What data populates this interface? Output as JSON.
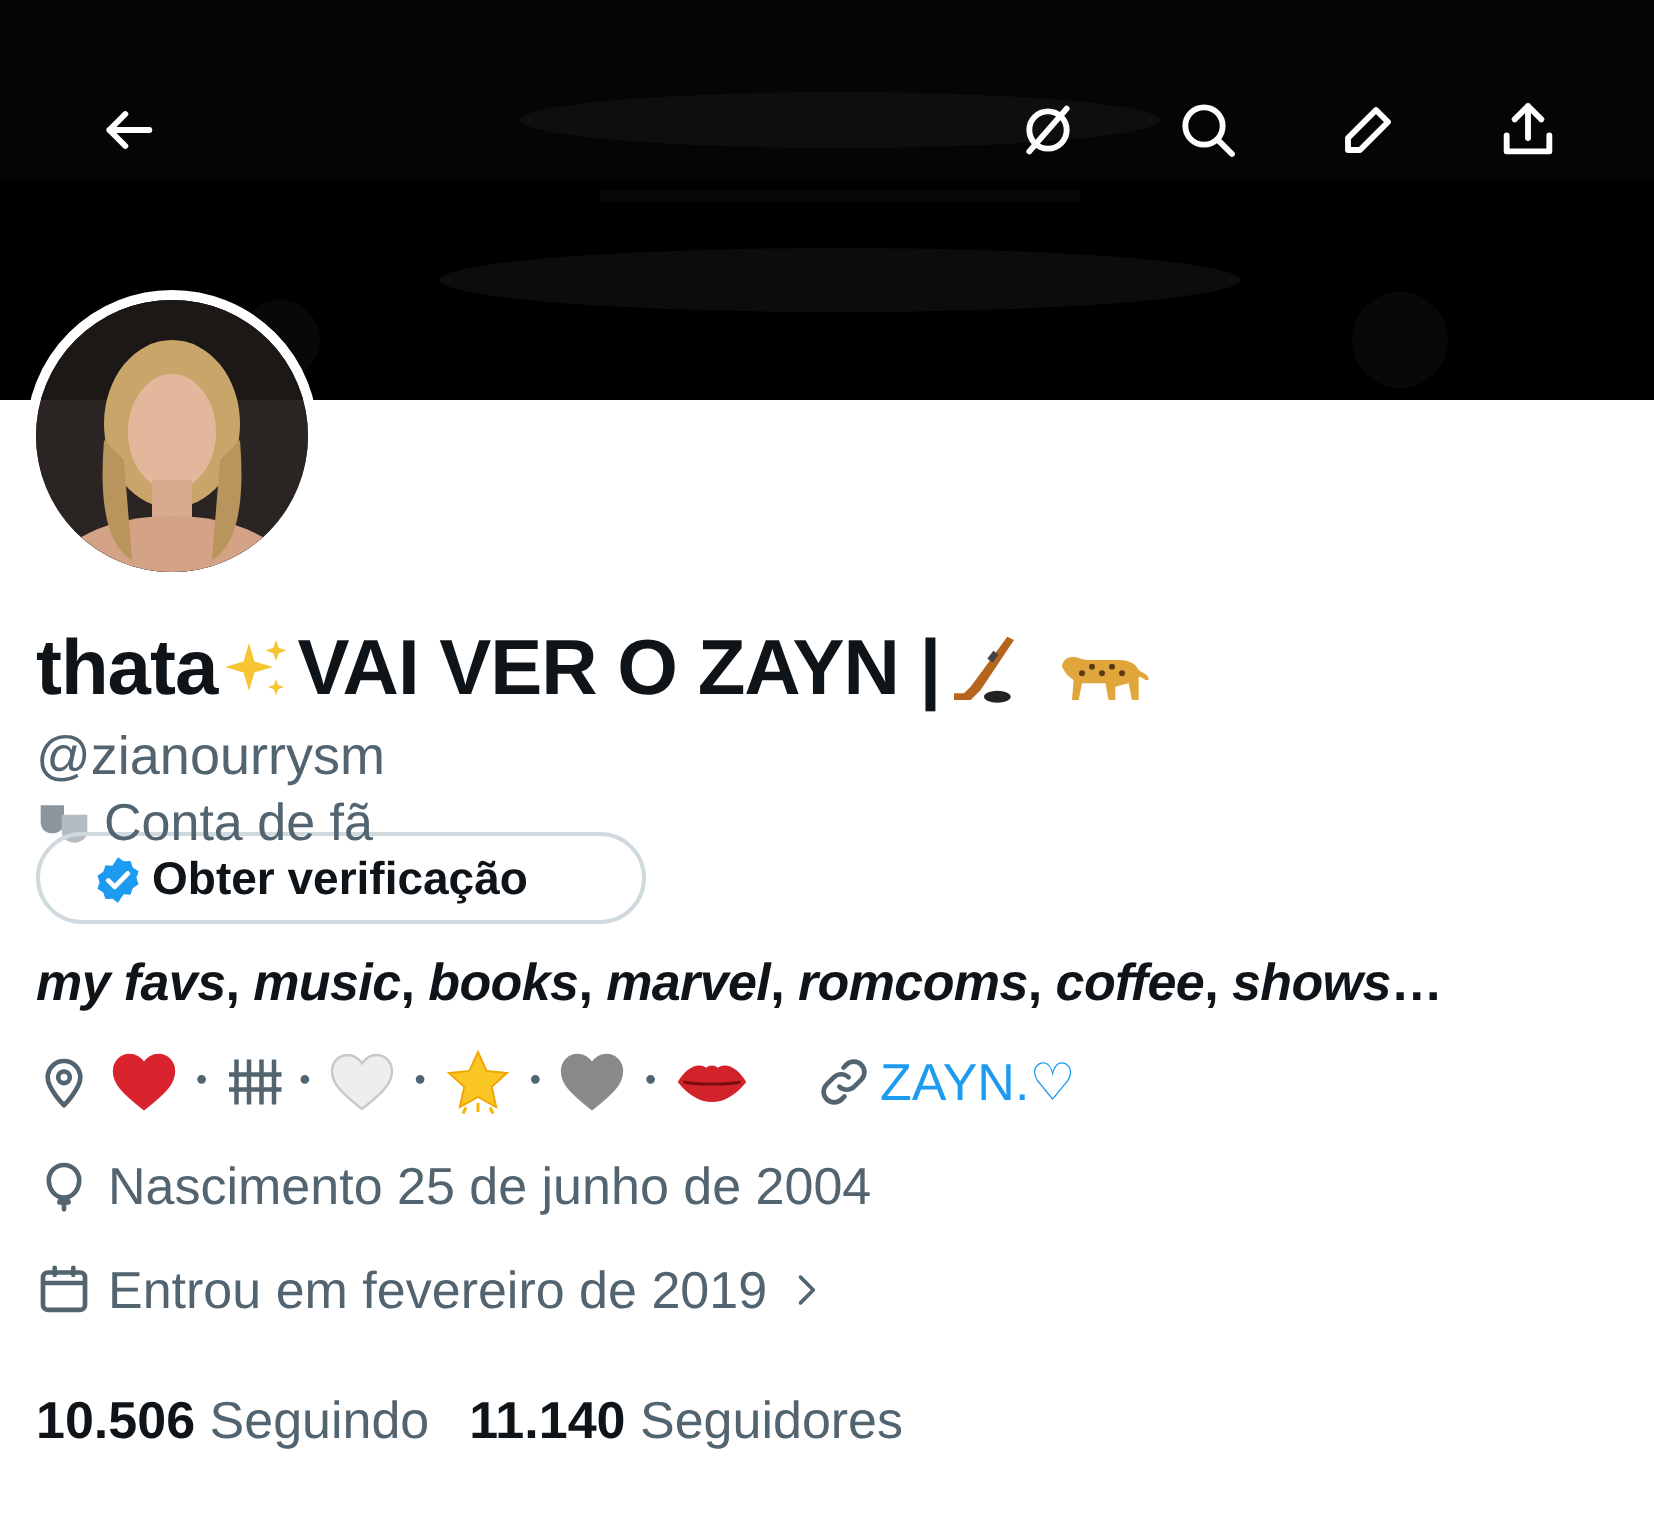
{
  "header": {
    "buttons": [
      {
        "kind": "back"
      },
      {
        "kind": "slashed"
      },
      {
        "kind": "search"
      },
      {
        "kind": "edit"
      },
      {
        "kind": "share"
      }
    ]
  },
  "profile": {
    "name_parts": [
      {
        "kind": "text",
        "text": "thata"
      },
      {
        "kind": "sparkles"
      },
      {
        "kind": "text",
        "text": "VAI VER O ZAYN |"
      },
      {
        "kind": "hockey"
      },
      {
        "kind": "leopard"
      }
    ],
    "handle": "@zianourrysm",
    "category": "Conta de fã",
    "verify_button": "Obter verificação",
    "bio": "*my favs*, *music*, *books*, *marvel*, *romcoms*, *coffee*, *shows*…",
    "location": [
      {
        "kind": "heart",
        "color": "#d9232e"
      },
      {
        "kind": "separator",
        "text": "•"
      },
      {
        "kind": "tally"
      },
      {
        "kind": "separator",
        "text": "•"
      },
      {
        "kind": "heart",
        "color": "#eeeeee"
      },
      {
        "kind": "separator",
        "text": "•"
      },
      {
        "kind": "star"
      },
      {
        "kind": "separator",
        "text": "•"
      },
      {
        "kind": "heart",
        "color": "#8a8a8a"
      },
      {
        "kind": "separator",
        "text": "•"
      },
      {
        "kind": "lips"
      }
    ],
    "link": "ZAYN.♡",
    "birth": "Nascimento 25 de junho de 2004",
    "joined": "Entrou em fevereiro de 2019",
    "stats": [
      {
        "count": "10.506",
        "label": "Seguindo"
      },
      {
        "count": "11.140",
        "label": "Seguidores"
      }
    ]
  }
}
